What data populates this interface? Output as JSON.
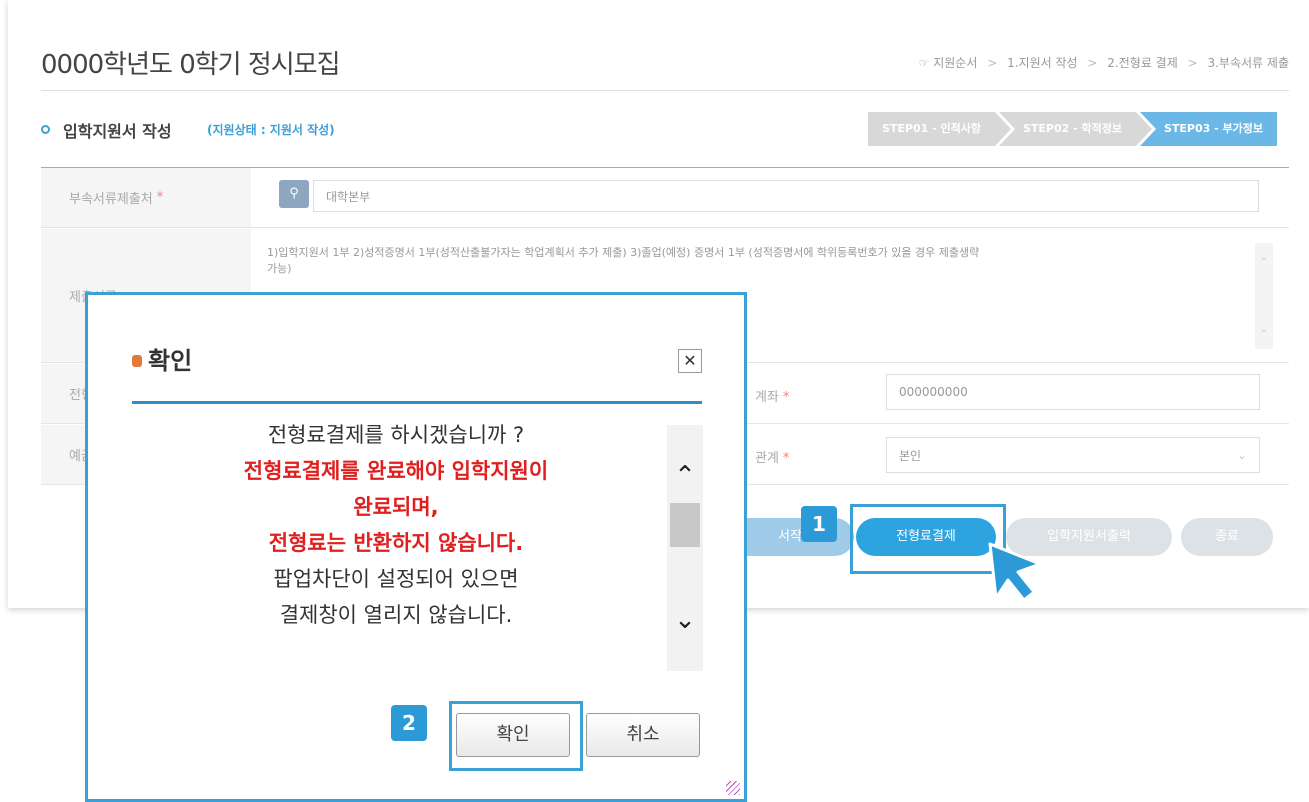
{
  "page": {
    "title": "0000학년도 0학기 정시모집",
    "breadcrumb": {
      "prefix": "☞ 지원순서",
      "steps": [
        "1.지원서 작성",
        "2.전형료 결제",
        "3.부속서류 제출"
      ],
      "separator": ">"
    }
  },
  "section": {
    "name": "입학지원서 작성",
    "state": "(지원상태 : 지원서 작성)"
  },
  "steps": [
    {
      "label": "STEP01 - 인적사항",
      "active": false
    },
    {
      "label": "STEP02 - 학적정보",
      "active": false
    },
    {
      "label": "STEP03 - 부가정보",
      "active": true
    }
  ],
  "form": {
    "office_label": "부속서류제출처",
    "office_value": "대학본부",
    "docs_label": "제출서류",
    "docs_text": "1)입학지원서 1부  2)성적증명서 1부(성적산출불가자는 학업계획서 추가 제출)  3)졸업(예정) 증명서 1부 (성적증명서에 학위등록번호가 있을 경우 제출생략가능)",
    "fee_label": "전형",
    "account_label": "계좌",
    "account_value": "000000000",
    "depositor_label": "예금",
    "relation_label": "관계",
    "relation_value": "본인",
    "required_mark": "*"
  },
  "actions": {
    "draft_label": "서작성",
    "pay_label": "전형료결제",
    "print_label": "입학지원서출력",
    "close_label": "종료"
  },
  "badges": {
    "one": "1",
    "two": "2"
  },
  "modal": {
    "title": "확인",
    "close_glyph": "✕",
    "line1": "전형료결제를 하시겠습니까 ?",
    "line2": "전형료결제를 완료해야 입학지원이",
    "line3": "완료되며,",
    "line4": "전형료는 반환하지 않습니다.",
    "line5": "팝업차단이 설정되어 있으면",
    "line6": "결제창이 열리지 않습니다.",
    "confirm_label": "확인",
    "cancel_label": "취소"
  },
  "colors": {
    "accent": "#3aa0d8",
    "warning": "#e02020"
  }
}
